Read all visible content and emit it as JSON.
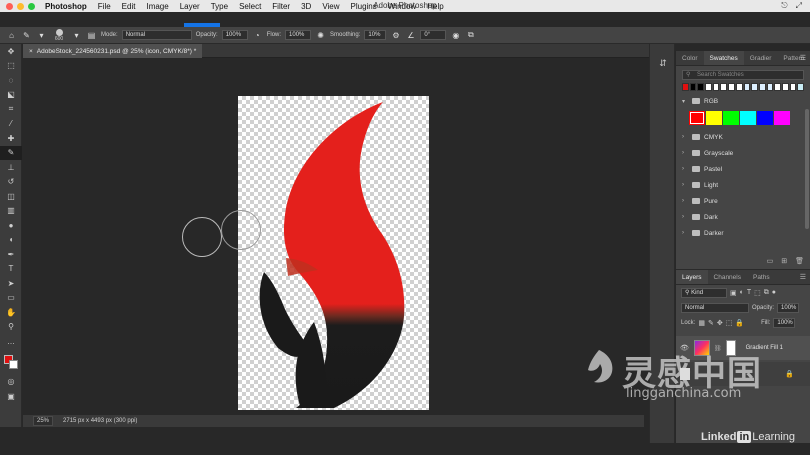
{
  "menubar": {
    "app": "Photoshop",
    "items": [
      "File",
      "Edit",
      "Image",
      "Layer",
      "Type",
      "Select",
      "Filter",
      "3D",
      "View",
      "Plugins",
      "Window",
      "Help"
    ],
    "window_title": "Adobe Photoshop",
    "traffic_colors": [
      "#ff5f57",
      "#febc2e",
      "#28c840"
    ]
  },
  "options": {
    "brush_size": "600",
    "mode_label": "Mode:",
    "mode_value": "Normal",
    "opacity_label": "Opacity:",
    "opacity_value": "100%",
    "flow_label": "Flow:",
    "flow_value": "100%",
    "smoothing_label": "Smoothing:",
    "smoothing_value": "10%",
    "angle_value": "0°"
  },
  "document": {
    "tab_title": "AdobeStock_224560231.psd @ 25% (icon, CMYK/8*) *"
  },
  "status": {
    "zoom": "25%",
    "doc_info": "2715 px x 4493 px (300 ppi)"
  },
  "swatches_panel": {
    "tabs": [
      "Color",
      "Swatches",
      "Gradier",
      "Pattern"
    ],
    "search_placeholder": "Search Swatches",
    "recent_colors": [
      "#e01010",
      "#000000",
      "#000000",
      "#ffffff",
      "#ffffff",
      "#ffffff",
      "#ffffff",
      "#ffffff",
      "#dcefff",
      "#dcefff",
      "#dcefff",
      "#dcefff",
      "#ffffff",
      "#ffffff",
      "#ffffff",
      "#c8ecf4"
    ],
    "rgb_group": "RGB",
    "rgb_colors": [
      "#ff0000",
      "#ffff00",
      "#00ff00",
      "#00ffff",
      "#0000ff",
      "#ff00ff"
    ],
    "groups": [
      "CMYK",
      "Grayscale",
      "Pastel",
      "Light",
      "Pure",
      "Dark",
      "Darker"
    ]
  },
  "layers_panel": {
    "tabs": [
      "Layers",
      "Channels",
      "Paths"
    ],
    "filter_value": "Kind",
    "blend_mode": "Normal",
    "opacity_label": "Opacity:",
    "opacity_value": "100%",
    "lock_label": "Lock:",
    "fill_label": "Fill:",
    "fill_value": "100%",
    "layer_name": "Gradient Fill 1"
  },
  "watermark": {
    "linkedin_pre": "Linked",
    "linkedin_in": "in",
    "linkedin_post": "Learning",
    "site_cn": "灵感中国",
    "site_en": "lingganchina.com"
  }
}
